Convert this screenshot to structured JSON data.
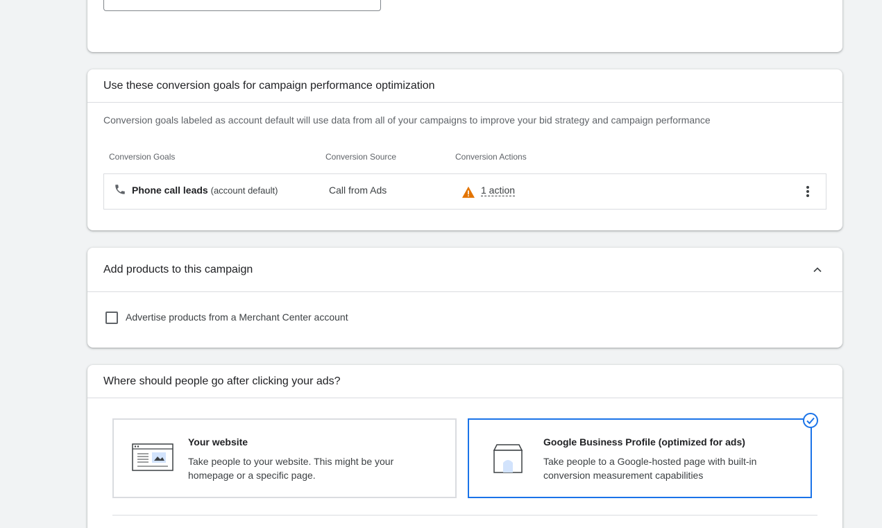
{
  "goals_section": {
    "title": "Use these conversion goals for campaign performance optimization",
    "description": "Conversion goals labeled as account default will use data from all of your campaigns to improve your bid strategy and campaign performance",
    "headers": {
      "goals": "Conversion Goals",
      "source": "Conversion Source",
      "actions": "Conversion Actions"
    },
    "rows": [
      {
        "icon": "phone-icon",
        "goal": "Phone call leads",
        "default_label": "(account default)",
        "source": "Call from Ads",
        "action_icon": "warning-icon",
        "actions": "1 action"
      }
    ]
  },
  "products_section": {
    "title": "Add products to this campaign",
    "checkbox_label": "Advertise products from a Merchant Center account",
    "checked": false
  },
  "destination_section": {
    "title": "Where should people go after clicking your ads?",
    "options": [
      {
        "title": "Your website",
        "description": "Take people to your website. This might be your homepage or a specific page.",
        "selected": false
      },
      {
        "title": "Google Business Profile (optimized for ads)",
        "description": "Take people to a Google-hosted page with built-in conversion measurement capabilities",
        "selected": true
      }
    ]
  },
  "colors": {
    "accent": "#1a73e8",
    "warning": "#e37400",
    "background": "#f1f3f4"
  }
}
